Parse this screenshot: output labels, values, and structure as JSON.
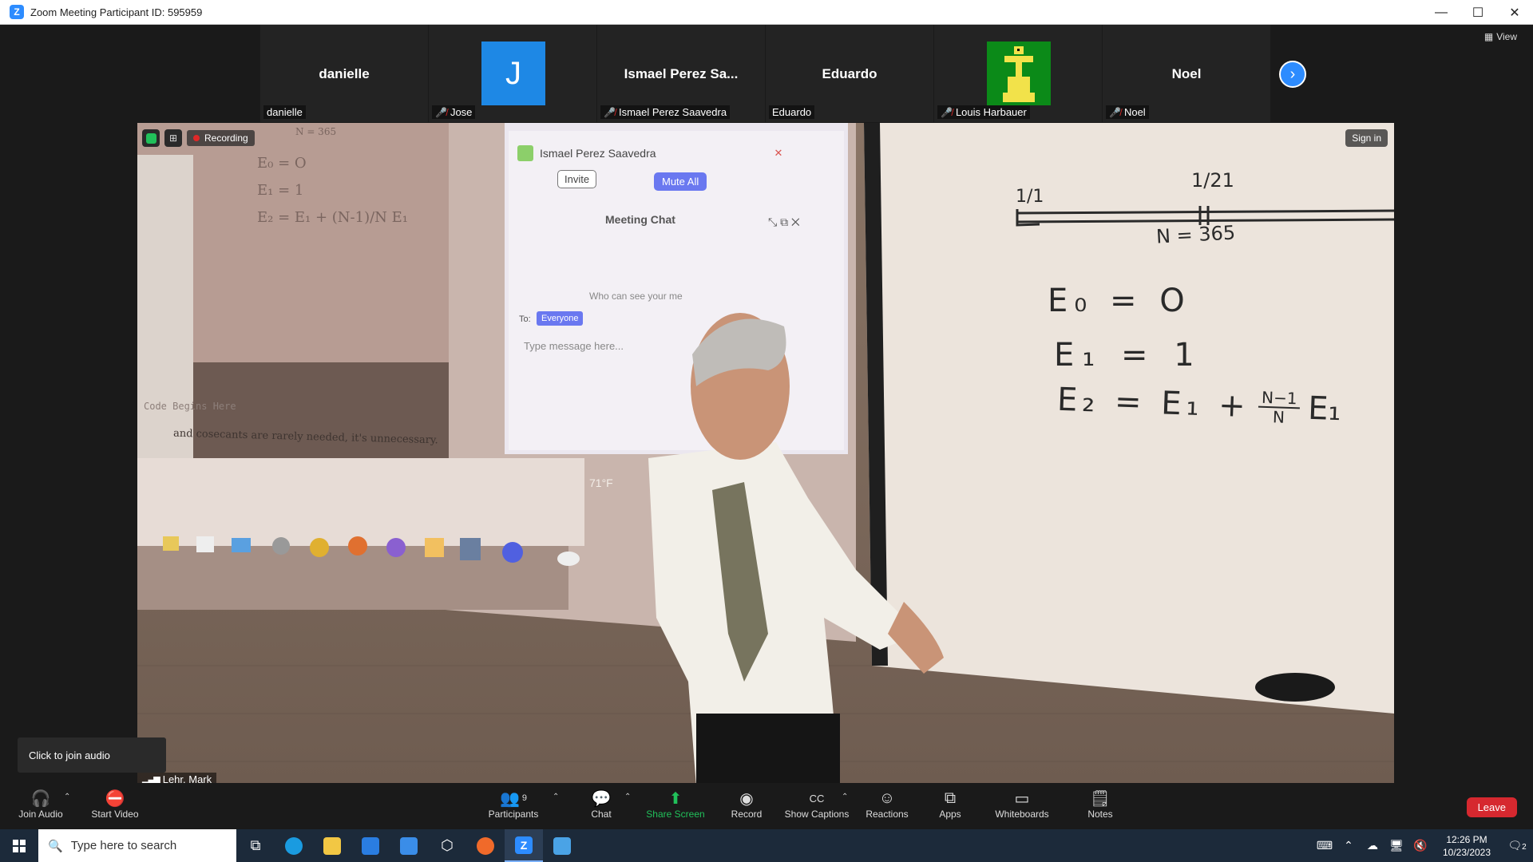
{
  "window": {
    "title": "Zoom Meeting Participant ID: 595959",
    "minimize": "—",
    "maximize": "☐",
    "close": "✕"
  },
  "view_button": "View",
  "participants_strip": [
    {
      "big_name": "danielle",
      "label": "danielle",
      "muted": false,
      "avatar": "none"
    },
    {
      "big_name": "",
      "label": "Jose",
      "muted": true,
      "avatar": "J"
    },
    {
      "big_name": "Ismael Perez Sa...",
      "label": "Ismael Perez Saavedra",
      "muted": true,
      "avatar": "none"
    },
    {
      "big_name": "Eduardo",
      "label": "Eduardo",
      "muted": false,
      "avatar": "none"
    },
    {
      "big_name": "",
      "label": "Louis Harbauer",
      "muted": true,
      "avatar": "duck-image"
    },
    {
      "big_name": "Noel",
      "label": "Noel",
      "muted": true,
      "avatar": "none"
    }
  ],
  "main_video": {
    "recording_label": "Recording",
    "sign_in": "Sign in",
    "projected_screen": {
      "participant_name": "Ismael Perez Saavedra",
      "invite": "Invite",
      "mute_all": "Mute All",
      "chat_title": "Meeting Chat",
      "who_can_see": "Who can see your me",
      "to_label": "To:",
      "to_value": "Everyone",
      "type_message": "Type message here...",
      "code_begins": "Code Begins Here",
      "cosecants_text": "and cosecants are rarely needed, it's unnecessary.",
      "weather": "71°F",
      "board_left": [
        "E₀ = O",
        "E₁ = 1",
        "E₂ = E₁ + (N-1)/N E₁"
      ],
      "n_value_small": "N = 365"
    },
    "whiteboard": {
      "fraction_left": "1/1",
      "fraction_right": "1/21",
      "n_value": "N = 365",
      "eq1": "E₀ = O",
      "eq2": "E₁ = 1",
      "eq3_left": "E₂ = E₁ +",
      "eq3_frac_num": "N−1",
      "eq3_frac_den": "N",
      "eq3_right": "E₁"
    }
  },
  "join_audio_tip": "Click to join audio",
  "active_speaker": "Lehr, Mark",
  "toolbar": {
    "join_audio": "Join Audio",
    "start_video": "Start Video",
    "participants": "Participants",
    "participants_count": "9",
    "chat": "Chat",
    "share_screen": "Share Screen",
    "record": "Record",
    "show_captions": "Show Captions",
    "reactions": "Reactions",
    "apps": "Apps",
    "whiteboards": "Whiteboards",
    "notes": "Notes",
    "leave": "Leave"
  },
  "taskbar": {
    "search_placeholder": "Type here to search",
    "time": "12:26 PM",
    "date": "10/23/2023",
    "notification_count": "2"
  },
  "colors": {
    "zoom_blue": "#2d8cff",
    "share_green": "#21c05a",
    "leave_red": "#d6282f",
    "mute_red": "#e02828"
  }
}
